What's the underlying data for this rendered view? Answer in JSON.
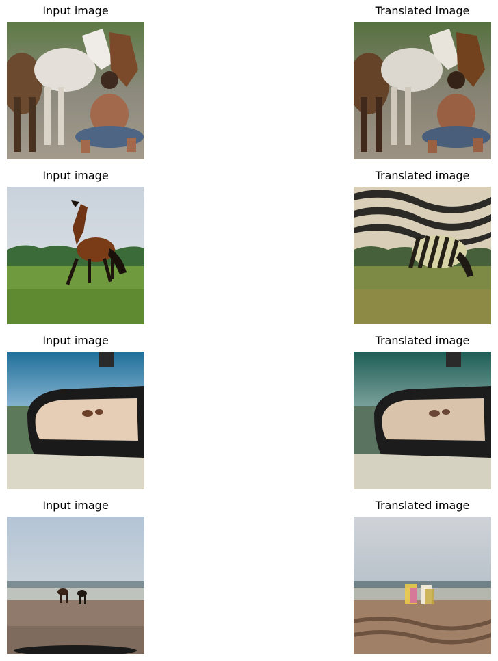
{
  "rows": [
    {
      "left_title": "Input image",
      "right_title": "Translated image",
      "left_scene": "man-with-horses",
      "right_scene": "man-with-horses"
    },
    {
      "left_title": "Input image",
      "right_title": "Translated image",
      "left_scene": "brown-horse-field",
      "right_scene": "zebra-striped-field"
    },
    {
      "left_title": "Input image",
      "right_title": "Translated image",
      "left_scene": "car-mirror-horses-beach",
      "right_scene": "car-mirror-horses-beach-teal"
    },
    {
      "left_title": "Input image",
      "right_title": "Translated image",
      "left_scene": "two-horses-on-beach",
      "right_scene": "blurred-beach-figures"
    }
  ]
}
